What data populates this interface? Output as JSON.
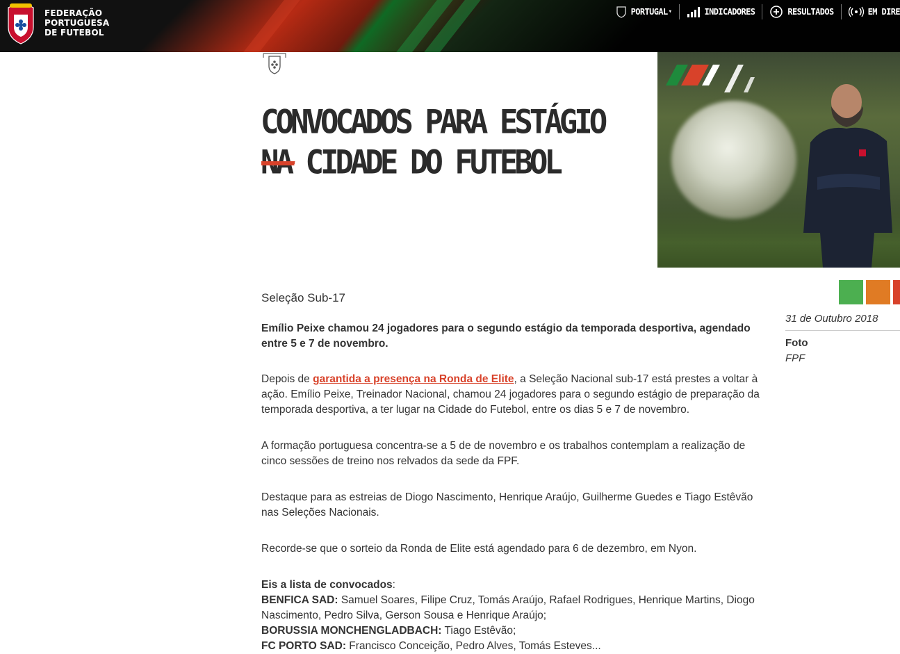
{
  "header": {
    "brand_lines": [
      "FEDERAÇÃO",
      "PORTUGUESA",
      "DE FUTEBOL"
    ],
    "nav": [
      {
        "label": "PORTUGAL",
        "icon": "crest-icon",
        "has_dropdown": true
      },
      {
        "label": "INDICADORES",
        "icon": "bar-chart-icon"
      },
      {
        "label": "RESULTADOS",
        "icon": "ball-plus-icon"
      },
      {
        "label": "EM DIRE",
        "icon": "broadcast-icon"
      }
    ]
  },
  "article": {
    "title_lines": [
      "CONVOCADOS PARA ESTÁGIO",
      "NA CIDADE DO FUTEBOL"
    ],
    "section": "Seleção Sub-17",
    "lead": "Emílio Peixe chamou 24 jogadores para o segundo estágio da temporada desportiva, agendado entre 5 e 7 de novembro.",
    "p1_before": "Depois de ",
    "p1_link": "garantida a presença na Ronda de Elite",
    "p1_after": ", a Seleção Nacional sub-17 está prestes a voltar à ação. Emílio Peixe, Treinador Nacional, chamou 24 jogadores para o segundo estágio de preparação da temporada desportiva, a ter lugar na Cidade do Futebol, entre os dias 5 e 7 de novembro.",
    "p2": "A formação portuguesa concentra-se a 5 de de novembro e os trabalhos contemplam a realização de cinco sessões de treino nos relvados da sede da FPF.",
    "p3": "Destaque para as estreias de Diogo Nascimento, Henrique Araújo, Guilherme Guedes e Tiago Estêvão nas Seleções Nacionais.",
    "p4": "Recorde-se que o sorteio da Ronda de Elite está agendado para 6 de dezembro, em Nyon.",
    "list_title": "Eis a lista de convocados",
    "list_colon": ":",
    "clubs": [
      {
        "club": "BENFICA SAD:",
        "players": " Samuel Soares, Filipe Cruz, Tomás Araújo, Rafael Rodrigues, Henrique Martins, Diogo Nascimento, Pedro Silva, Gerson Sousa e Henrique Araújo;"
      },
      {
        "club": "BORUSSIA MONCHENGLADBACH:",
        "players": " Tiago Estêvão;"
      },
      {
        "club": "FC PORTO SAD:",
        "players": " Francisco Conceição, Pedro Alves, Tomás Esteves..."
      }
    ]
  },
  "sidebar": {
    "date": "31 de Outubro 2018",
    "foto_label": "Foto",
    "foto_value": "FPF"
  },
  "share_colors": [
    "#4caf50",
    "#e07b24",
    "#d8422a"
  ],
  "colors": {
    "accent": "#d8422a",
    "header_bg": "#111111"
  }
}
